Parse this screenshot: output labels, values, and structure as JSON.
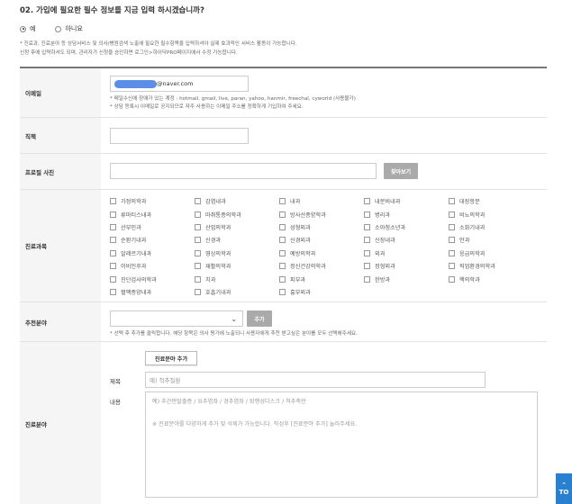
{
  "question": "02. 가입에 필요한 필수 정보를 지금 입력 하시겠습니까?",
  "radios": [
    {
      "label": "예",
      "checked": true
    },
    {
      "label": "아니요",
      "checked": false
    }
  ],
  "notice": {
    "line1": "* 진료과, 진료분야 등 상담서비스 및 의사/병원검색 노출에 필요한 필수항목을 입력하셔야 실제 효과적인 서비스 활동이 가능합니다.",
    "line2": "신청 후에 입력하셔도 되며, 관리자가 신청을 승인하면 로그인>하이닥PRO페이지에서 수정 가능합니다."
  },
  "email": {
    "label": "이메일",
    "value_suffix": "@naver.com",
    "hint1": "* 메일수신에 장애가 있는 계정 : hotmail, gmail, live, paran, yahoo, hanmir, freechal, cyworld (사용불가)",
    "hint2": "* 상담 등록시 이메일로 공지되므로 자주 사용하는 이메일 주소를 정확하게 기입하여 주세요."
  },
  "position": {
    "label": "직책",
    "value": ""
  },
  "photo": {
    "label": "프로필 사진",
    "value": "",
    "button": "찾아보기"
  },
  "departments": {
    "label": "진료과목",
    "items": [
      "가정의학과",
      "감염내과",
      "내과",
      "내분비내과",
      "대장항문",
      "류마티스내과",
      "마취통증의학과",
      "방사선종양학과",
      "병리과",
      "비뇨의학과",
      "산부인과",
      "산업의학과",
      "성형외과",
      "소아청소년과",
      "소화기내과",
      "순환기내과",
      "신경과",
      "신경외과",
      "신장내과",
      "안과",
      "알레르기내과",
      "영상의학과",
      "예방의학과",
      "외과",
      "응급의학과",
      "이비인후과",
      "재활의학과",
      "정신건강의학과",
      "정형외과",
      "직업환경의학과",
      "진단검사의학과",
      "치과",
      "피부과",
      "한방과",
      "핵의학과",
      "혈액종양내과",
      "호흡기내과",
      "흉부외과"
    ]
  },
  "recommend": {
    "label": "추천분야",
    "select_value": "",
    "add_button": "추가",
    "hint": "* 선택 후 추가를 클릭합니다. 해당 항목은 의사 평가에 노출되니 사용자에게 추천 받고싶은 분야를 모두 선택해주세요."
  },
  "specialty": {
    "label": "진료분야",
    "add_button": "진료분야 추가",
    "title_label": "제목",
    "title_placeholder": "예) 척추질환",
    "content_label": "내용",
    "content_placeholder_line1": "예) 추간판탈출증 / 요추염좌 / 경추염좌 / 퇴행성디스크 / 척추측만",
    "content_placeholder_line2": "※ 진료분야를 다양하게 추가 및 삭제가 가능합니다. 작성후 [진료분야 추가] 눌러주세요."
  },
  "top_button": {
    "label": "TO"
  }
}
